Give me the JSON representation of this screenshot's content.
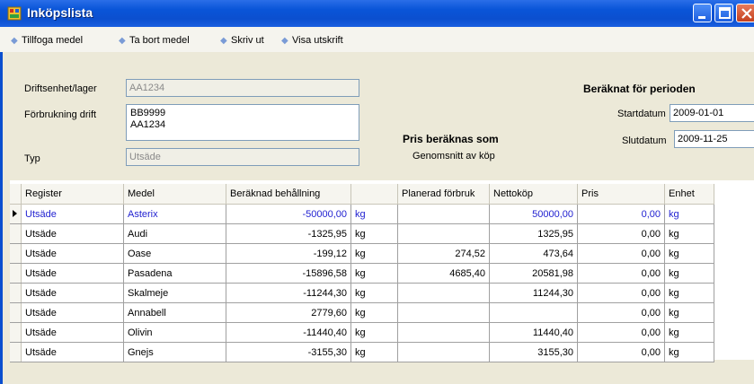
{
  "window": {
    "title": "Inköpslista"
  },
  "toolbar": {
    "items": [
      {
        "label": "Tillfoga medel"
      },
      {
        "label": "Ta bort medel"
      },
      {
        "label": "Skriv ut"
      },
      {
        "label": "Visa utskrift"
      }
    ]
  },
  "form": {
    "driftsenhet_label": "Driftsenhet/lager",
    "driftsenhet_value": "AA1234",
    "forbrukning_label": "Förbrukning drift",
    "forbrukning_line1": "BB9999",
    "forbrukning_line2": "AA1234",
    "typ_label": "Typ",
    "typ_value": "Utsäde",
    "pris_heading": "Pris beräknas som",
    "pris_value": "Genomsnitt av köp",
    "period_heading": "Beräknat för perioden",
    "startdatum_label": "Startdatum",
    "startdatum_value": "2009-01-01",
    "slutdatum_label": "Slutdatum",
    "slutdatum_value": "2009-11-25"
  },
  "grid": {
    "columns": [
      "Register",
      "Medel",
      "Beräknad behållning",
      "",
      "Planerad förbruk",
      "Nettoköp",
      "Pris",
      "Enhet"
    ],
    "rows": [
      [
        "Utsäde",
        "Asterix",
        "-50000,00",
        "kg",
        "",
        "50000,00",
        "0,00",
        "kg"
      ],
      [
        "Utsäde",
        "Audi",
        "-1325,95",
        "kg",
        "",
        "1325,95",
        "0,00",
        "kg"
      ],
      [
        "Utsäde",
        "Oase",
        "-199,12",
        "kg",
        "274,52",
        "473,64",
        "0,00",
        "kg"
      ],
      [
        "Utsäde",
        "Pasadena",
        "-15896,58",
        "kg",
        "4685,40",
        "20581,98",
        "0,00",
        "kg"
      ],
      [
        "Utsäde",
        "Skalmeje",
        "-11244,30",
        "kg",
        "",
        "11244,30",
        "0,00",
        "kg"
      ],
      [
        "Utsäde",
        "Annabell",
        "2779,60",
        "kg",
        "",
        "",
        "0,00",
        "kg"
      ],
      [
        "Utsäde",
        "Olivin",
        "-11440,40",
        "kg",
        "",
        "11440,40",
        "0,00",
        "kg"
      ],
      [
        "Utsäde",
        "Gnejs",
        "-3155,30",
        "kg",
        "",
        "3155,30",
        "0,00",
        "kg"
      ]
    ]
  }
}
